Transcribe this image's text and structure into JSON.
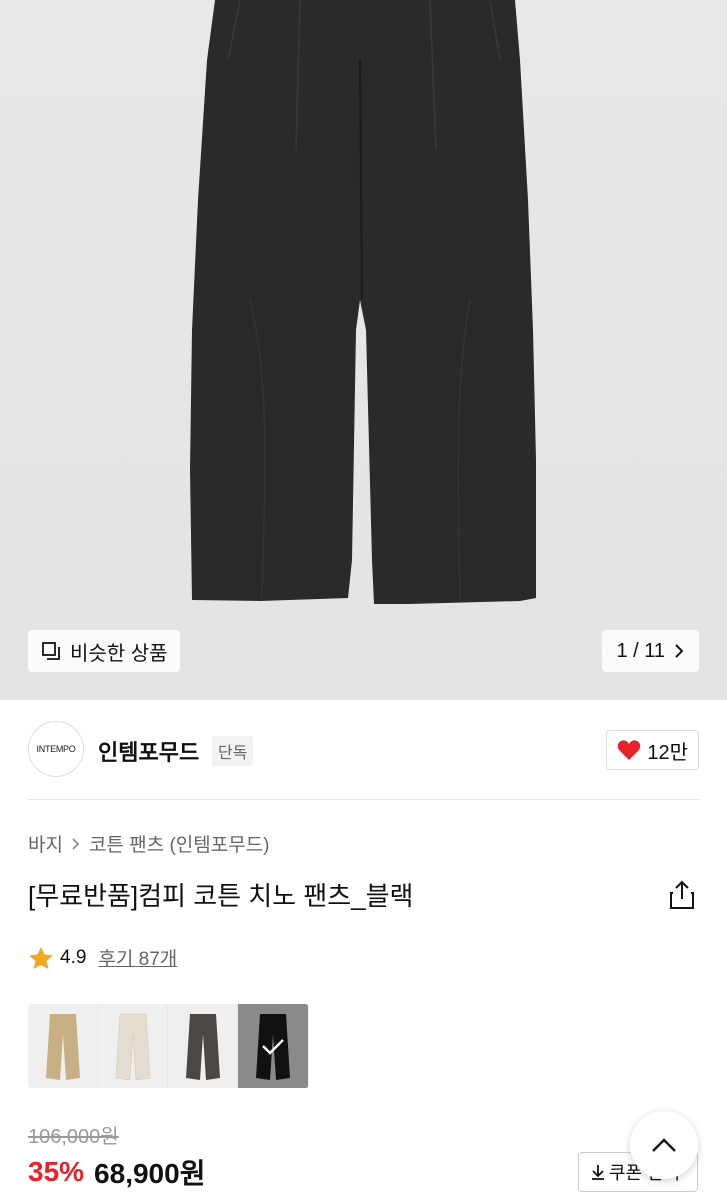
{
  "gallery": {
    "similar_label": "비슷한 상품",
    "pager": "1 / 11"
  },
  "brand": {
    "logo_text": "INTEMPO",
    "name": "인템포무드",
    "tag": "단독",
    "likes": "12만"
  },
  "breadcrumb": {
    "category": "바지",
    "subcategory": "코튼 팬츠 (인템포무드)"
  },
  "product": {
    "title": "[무료반품]컴피 코튼 치노 팬츠_블랙",
    "rating": "4.9",
    "reviews": "후기 87개",
    "colors": [
      {
        "name": "beige",
        "hex": "#c9b084"
      },
      {
        "name": "ivory",
        "hex": "#e3ddcf"
      },
      {
        "name": "charcoal",
        "hex": "#4a4744"
      },
      {
        "name": "black",
        "hex": "#111111"
      }
    ],
    "original_price": "106,000원",
    "discount": "35%",
    "price": "68,900원",
    "coupon_label": "쿠폰 받기"
  },
  "colors": {
    "accent_red": "#e8222a",
    "heart_red": "#e8222a",
    "star": "#f5a623"
  }
}
